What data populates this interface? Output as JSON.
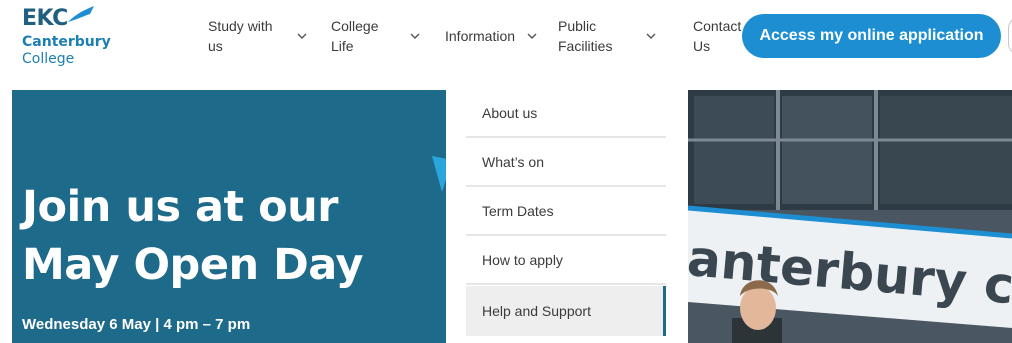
{
  "logo": {
    "line0": "EKC",
    "line1": "Canterbury",
    "line2": "College"
  },
  "nav": {
    "items": [
      {
        "line1": "Study with",
        "line2": "us"
      },
      {
        "line1": "College",
        "line2": "Life"
      },
      {
        "line1": "Information",
        "line2": ""
      },
      {
        "line1": "Public",
        "line2": "Facilities"
      },
      {
        "line1": "Contact",
        "line2": "Us"
      }
    ],
    "cta_label": "Access my online application"
  },
  "hero": {
    "title_line1": "Join us at our",
    "title_line2": "May Open Day",
    "subtitle": "Wednesday 6 May | 4 pm – 7 pm",
    "photo_sign_text": "anterbury co"
  },
  "dropdown": {
    "items": [
      "About us",
      "What’s on",
      "Term Dates",
      "How to apply",
      "Help and Support"
    ],
    "active_index": 4
  },
  "colors": {
    "brand_blue": "#1c8ed1",
    "hero_teal": "#1e6a8a",
    "logo_dark": "#1f5f7f",
    "logo_blue": "#1c7fb3"
  },
  "icons": {
    "nav_chevron": "chevron-down-icon"
  }
}
